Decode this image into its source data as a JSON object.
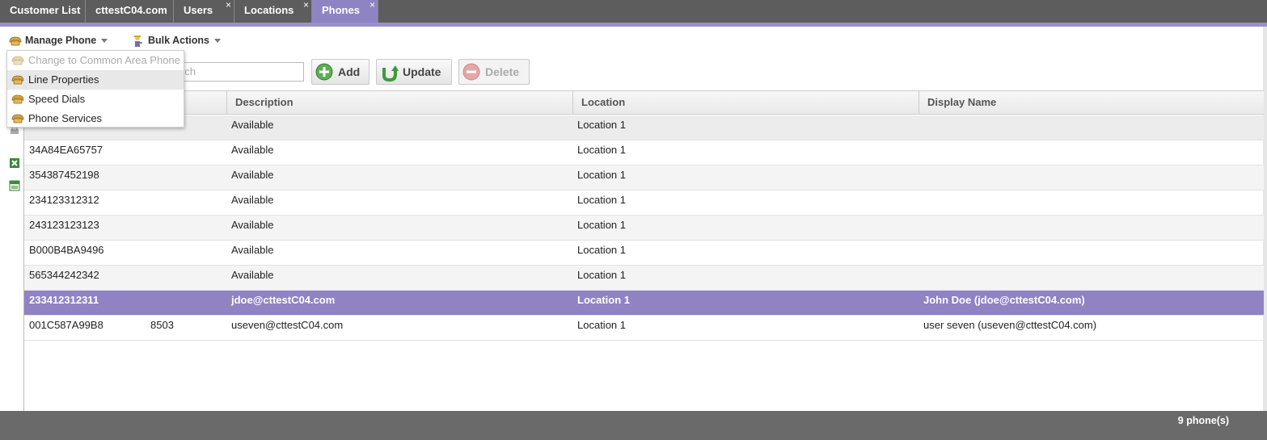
{
  "tabs": [
    {
      "label": "Customer List",
      "closable": false,
      "active": false
    },
    {
      "label": "cttestC04.com",
      "closable": false,
      "active": false
    },
    {
      "label": "Users",
      "closable": true,
      "active": false
    },
    {
      "label": "Locations",
      "closable": true,
      "active": false
    },
    {
      "label": "Phones",
      "closable": true,
      "active": true
    }
  ],
  "tab_close_glyph": "×",
  "menubar": {
    "manage_phone": "Manage Phone",
    "bulk_actions": "Bulk Actions"
  },
  "manage_menu": {
    "items": [
      {
        "label": "Change to Common Area Phone",
        "disabled": true
      },
      {
        "label": "Line Properties",
        "hovered": true
      },
      {
        "label": "Speed Dials"
      },
      {
        "label": "Phone Services"
      }
    ]
  },
  "toolbar": {
    "search_placeholder_visible": "rch",
    "add_label": "Add",
    "update_label": "Update",
    "delete_label": "Delete"
  },
  "grid": {
    "columns": [
      "Description",
      "Location",
      "Display Name"
    ],
    "rows": [
      {
        "name": "",
        "line": "",
        "description": "Available",
        "location": "Location 1",
        "display_name": ""
      },
      {
        "name": "34A84EA65757",
        "line": "",
        "description": "Available",
        "location": "Location 1",
        "display_name": ""
      },
      {
        "name": "354387452198",
        "line": "",
        "description": "Available",
        "location": "Location 1",
        "display_name": ""
      },
      {
        "name": "234123312312",
        "line": "",
        "description": "Available",
        "location": "Location 1",
        "display_name": ""
      },
      {
        "name": "243123123123",
        "line": "",
        "description": "Available",
        "location": "Location 1",
        "display_name": ""
      },
      {
        "name": "B000B4BA9496",
        "line": "",
        "description": "Available",
        "location": "Location 1",
        "display_name": ""
      },
      {
        "name": "565344242342",
        "line": "",
        "description": "Available",
        "location": "Location 1",
        "display_name": ""
      },
      {
        "name": "233412312311",
        "line": "",
        "description": "jdoe@cttestC04.com",
        "location": "Location 1",
        "display_name": "John Doe (jdoe@cttestC04.com)",
        "selected": true
      },
      {
        "name": "001C587A99B8",
        "line": "8503",
        "description": "useven@cttestC04.com",
        "location": "Location 1",
        "display_name": "user seven (useven@cttestC04.com)"
      }
    ]
  },
  "footer": {
    "count": "9 phone(s)"
  },
  "colors": {
    "accent": "#8e84c4",
    "selected_row": "#9182c4",
    "tabbar": "#5d5d5d"
  },
  "icons": [
    "phone-icon",
    "worker-icon",
    "add-icon",
    "update-icon",
    "delete-icon",
    "excel-icon",
    "csv-icon",
    "print-icon"
  ]
}
